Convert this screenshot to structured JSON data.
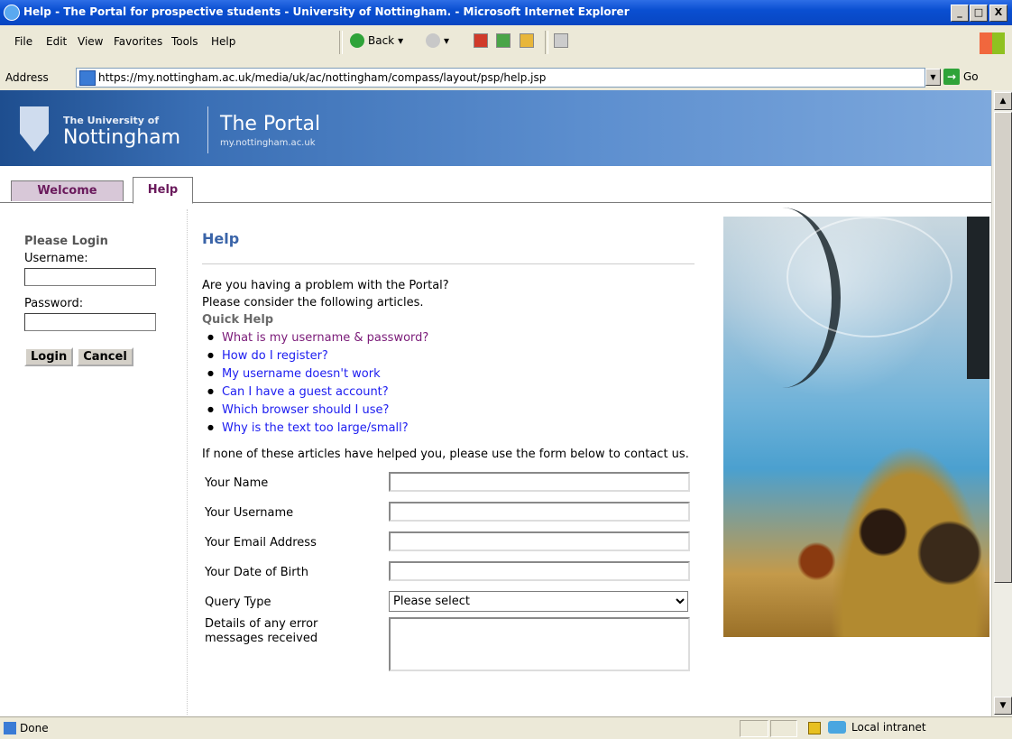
{
  "window": {
    "title": "Help - The Portal for prospective students - University of Nottingham. - Microsoft Internet Explorer",
    "min": "_",
    "max": "□",
    "close": "X"
  },
  "menubar": {
    "items": [
      "File",
      "Edit",
      "View",
      "Favorites",
      "Tools",
      "Help"
    ],
    "back_label": "Back"
  },
  "address": {
    "label": "Address",
    "url": "https://my.nottingham.ac.uk/media/uk/ac/nottingham/compass/layout/psp/help.jsp",
    "go_label": "Go"
  },
  "banner": {
    "uni_small": "The University of",
    "uni_big": "Nottingham",
    "portal_title": "The Portal",
    "portal_sub": "my.nottingham.ac.uk"
  },
  "tabs": [
    {
      "label": "Welcome",
      "active": false
    },
    {
      "label": "Help",
      "active": true
    }
  ],
  "login": {
    "heading": "Please Login",
    "username_label": "Username:",
    "password_label": "Password:",
    "username_value": "",
    "password_value": "",
    "login_button": "Login",
    "cancel_button": "Cancel"
  },
  "main": {
    "title": "Help",
    "intro_line1": "Are you having a problem with the Portal?",
    "intro_line2": "Please consider the following articles.",
    "quick_help_heading": "Quick Help",
    "links": [
      {
        "text": "What is my username & password?",
        "visited": true
      },
      {
        "text": "How do I register?",
        "visited": false
      },
      {
        "text": "My username doesn't work",
        "visited": false
      },
      {
        "text": "Can I have a guest account?",
        "visited": false
      },
      {
        "text": "Which browser should I use?",
        "visited": false
      },
      {
        "text": "Why is the text too large/small?",
        "visited": false
      }
    ],
    "contact_text": "If none of these articles have helped you, please use the form below to contact us.",
    "form": {
      "name_label": "Your Name",
      "username_label": "Your Username",
      "email_label": "Your Email Address",
      "dob_label": "Your Date of Birth",
      "query_label": "Query Type",
      "query_selected": "Please select",
      "details_label": "Details of any error messages received"
    }
  },
  "status": {
    "text": "Done",
    "zone": "Local intranet"
  }
}
